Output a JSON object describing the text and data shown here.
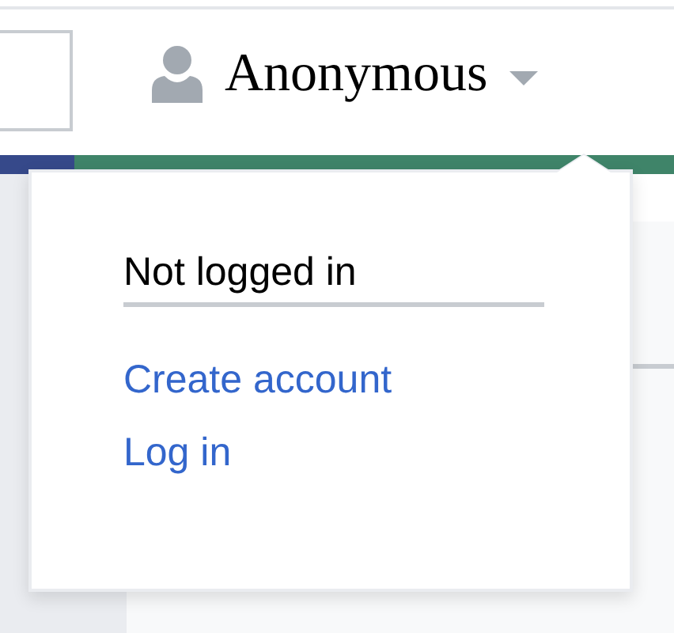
{
  "user_menu": {
    "username": "Anonymous"
  },
  "popup": {
    "heading": "Not logged in",
    "links": [
      "Create account",
      "Log in"
    ]
  }
}
